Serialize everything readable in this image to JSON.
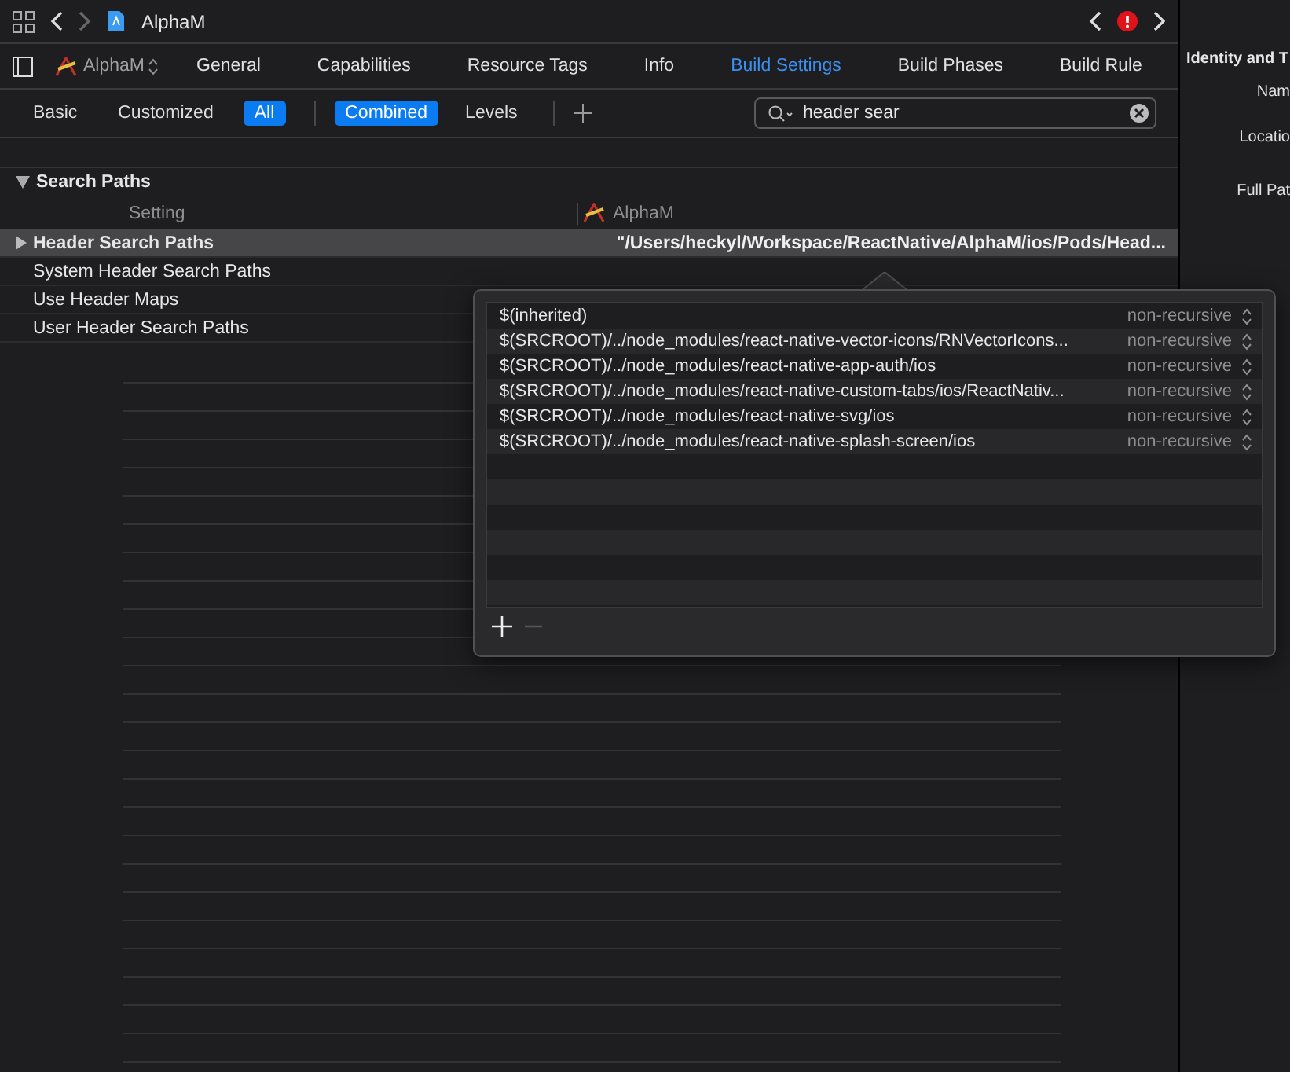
{
  "toolbar": {
    "title": "AlphaM"
  },
  "editor_tabs": {
    "target": "AlphaM",
    "tabs": [
      {
        "label": "General",
        "selected": false
      },
      {
        "label": "Capabilities",
        "selected": false
      },
      {
        "label": "Resource Tags",
        "selected": false
      },
      {
        "label": "Info",
        "selected": false
      },
      {
        "label": "Build Settings",
        "selected": true
      },
      {
        "label": "Build Phases",
        "selected": false
      },
      {
        "label": "Build Rule",
        "selected": false
      }
    ]
  },
  "filter_bar": {
    "scopes": [
      {
        "label": "Basic",
        "selected": false
      },
      {
        "label": "Customized",
        "selected": false
      },
      {
        "label": "All",
        "selected": true
      }
    ],
    "views": [
      {
        "label": "Combined",
        "selected": true
      },
      {
        "label": "Levels",
        "selected": false
      }
    ],
    "search": {
      "value": "header sear"
    }
  },
  "section": {
    "title": "Search Paths",
    "expanded": true,
    "columns": [
      "Setting",
      "AlphaM"
    ],
    "rows": [
      {
        "name": "Header Search Paths",
        "value": "\"/Users/heckyl/Workspace/ReactNative/AlphaM/ios/Pods/Head...",
        "selected": true,
        "expandable": true
      },
      {
        "name": "System Header Search Paths",
        "selected": false,
        "expandable": false
      },
      {
        "name": "Use Header Maps",
        "selected": false,
        "expandable": false
      },
      {
        "name": "User Header Search Paths",
        "selected": false,
        "expandable": false
      }
    ]
  },
  "popover": {
    "rows": [
      {
        "path": "$(inherited)",
        "mode": "non-recursive"
      },
      {
        "path": "$(SRCROOT)/../node_modules/react-native-vector-icons/RNVectorIcons...",
        "mode": "non-recursive"
      },
      {
        "path": "$(SRCROOT)/../node_modules/react-native-app-auth/ios",
        "mode": "non-recursive"
      },
      {
        "path": "$(SRCROOT)/../node_modules/react-native-custom-tabs/ios/ReactNativ...",
        "mode": "non-recursive"
      },
      {
        "path": "$(SRCROOT)/../node_modules/react-native-svg/ios",
        "mode": "non-recursive"
      },
      {
        "path": "$(SRCROOT)/../node_modules/react-native-splash-screen/ios",
        "mode": "non-recursive"
      }
    ],
    "add_disabled": false,
    "remove_disabled": true
  },
  "inspector": {
    "title": "Identity and T",
    "labels": [
      "Nam",
      "Locatio",
      "Full Pat"
    ]
  }
}
